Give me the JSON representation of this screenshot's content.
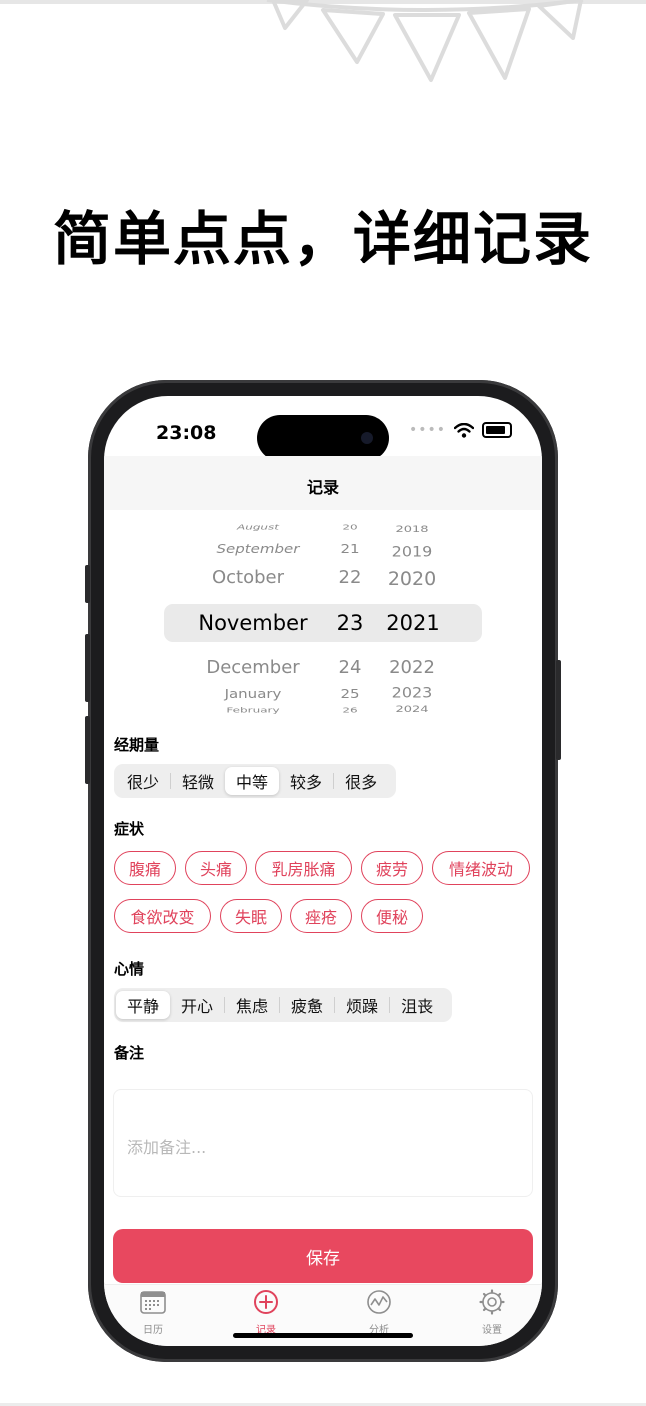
{
  "headline": "简单点点，详细记录",
  "status": {
    "time": "23:08",
    "dots": "••••"
  },
  "nav": {
    "title": "记录"
  },
  "picker": {
    "months": [
      "August",
      "September",
      "October",
      "November",
      "December",
      "January",
      "February"
    ],
    "days": [
      "20",
      "21",
      "22",
      "23",
      "24",
      "25",
      "26"
    ],
    "years": [
      "2018",
      "2019",
      "2020",
      "2021",
      "2022",
      "2023",
      "2024"
    ],
    "selected": {
      "month": "November",
      "day": "23",
      "year": "2021"
    }
  },
  "flow": {
    "label": "经期量",
    "options": [
      "很少",
      "轻微",
      "中等",
      "较多",
      "很多"
    ],
    "selected": "中等"
  },
  "symptoms": {
    "label": "症状",
    "options": [
      "腹痛",
      "头痛",
      "乳房胀痛",
      "疲劳",
      "情绪波动",
      "食欲改变",
      "失眠",
      "痤疮",
      "便秘"
    ]
  },
  "mood": {
    "label": "心情",
    "options": [
      "平静",
      "开心",
      "焦虑",
      "疲惫",
      "烦躁",
      "沮丧"
    ],
    "selected": "平静"
  },
  "note": {
    "label": "备注",
    "placeholder": "添加备注..."
  },
  "save_label": "保存",
  "tabs": [
    {
      "label": "日历",
      "icon": "calendar-icon",
      "active": false
    },
    {
      "label": "记录",
      "icon": "plus-circle-icon",
      "active": true
    },
    {
      "label": "分析",
      "icon": "chart-icon",
      "active": false
    },
    {
      "label": "设置",
      "icon": "gear-icon",
      "active": false
    }
  ],
  "colors": {
    "accent": "#e0435c",
    "save_button": "#e8485f"
  }
}
